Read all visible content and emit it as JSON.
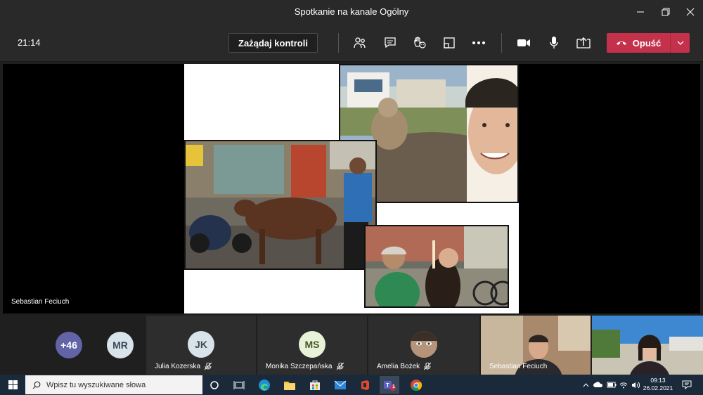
{
  "window": {
    "title": "Spotkanie na kanale Ogólny"
  },
  "controls": {
    "time": "21:14",
    "request_control_label": "Zażądaj kontroli",
    "leave_label": "Opuść"
  },
  "stage": {
    "presenter_name": "Sebastian Feciuch"
  },
  "participants": {
    "overflow_count": "+46",
    "items": [
      {
        "initials": "MR",
        "name": ""
      },
      {
        "initials": "JK",
        "name": "Julia Kozerska"
      },
      {
        "initials": "MS",
        "name": "Monika Szczepańska"
      },
      {
        "initials": "",
        "name": "Amelia Bożek"
      },
      {
        "initials": "",
        "name": "Sebastian Feciuch"
      },
      {
        "initials": "",
        "name": ""
      }
    ]
  },
  "taskbar": {
    "search_placeholder": "Wpisz tu wyszukiwane słowa",
    "clock_time": "09:13",
    "clock_date": "26.02.2021",
    "teams_badge": "1"
  },
  "colors": {
    "leave": "#c4314b",
    "overflow_avatar": "#6264a7",
    "taskbar": "#1b2a3a"
  }
}
